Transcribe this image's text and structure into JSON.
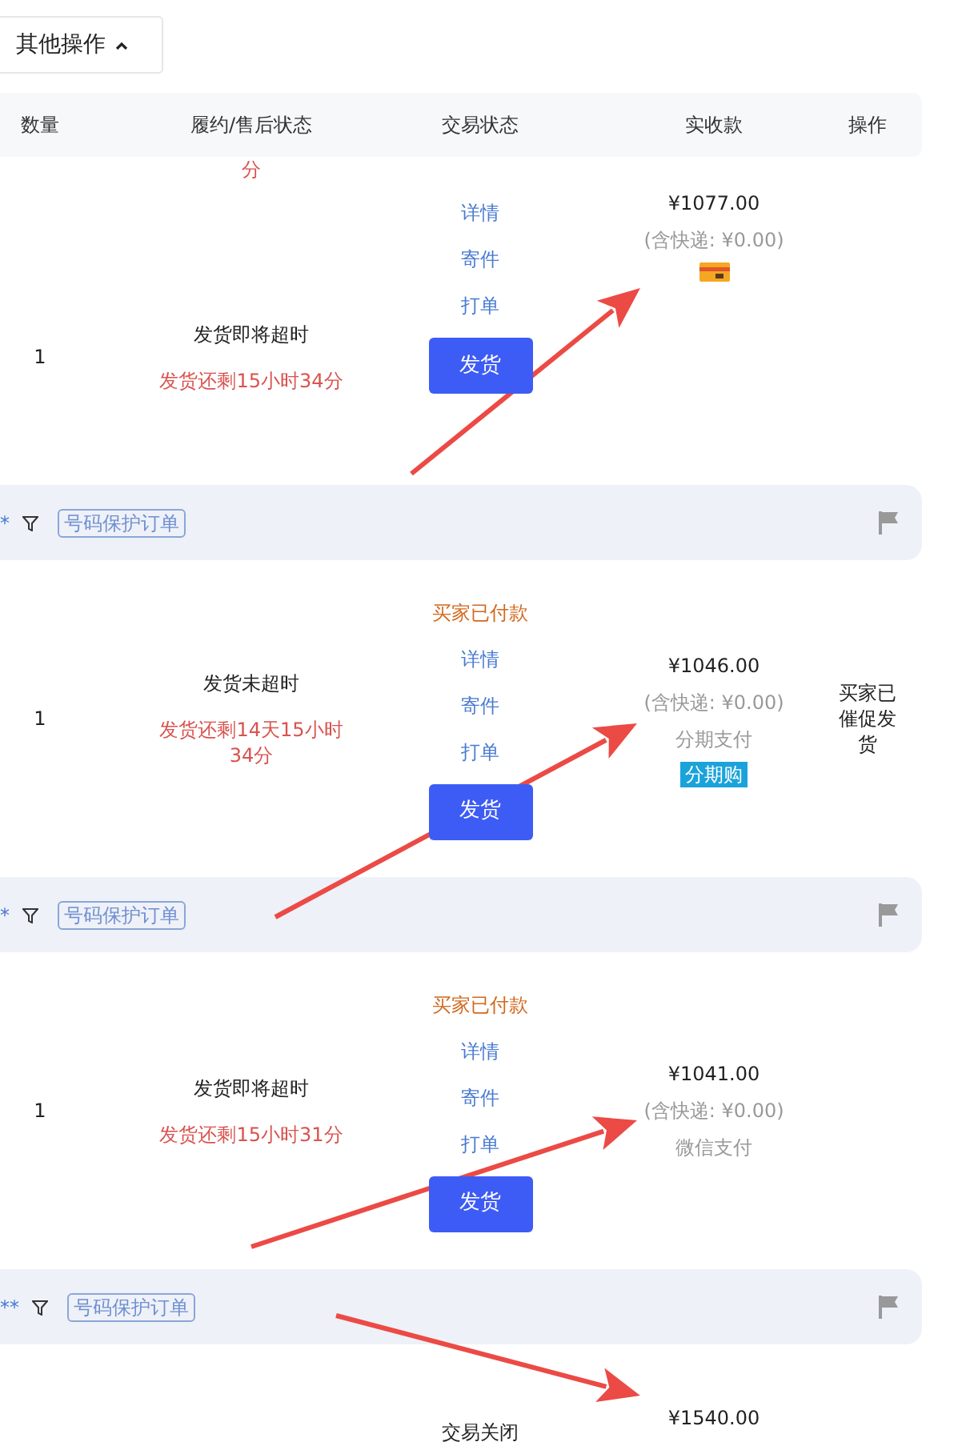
{
  "toolbar": {
    "dropdown": {
      "label": "其他操作",
      "expanded": true
    }
  },
  "table": {
    "columns": [
      "数量",
      "履约/售后状态",
      "交易状态",
      "实收款",
      "操作"
    ],
    "rows": [
      {
        "kind": "tail",
        "fulfillment": [
          {
            "kind": "countdown",
            "text": "分"
          }
        ]
      },
      {
        "kind": "order",
        "quantity": "1",
        "fulfillment": [
          {
            "kind": "title",
            "text": "发货即将超时"
          },
          {
            "kind": "countdown",
            "text": "发货还剩15小时34分"
          }
        ],
        "trade": [
          {
            "kind": "link",
            "text": "详情"
          },
          {
            "kind": "link",
            "text": "寄件"
          },
          {
            "kind": "link",
            "text": "打单"
          },
          {
            "kind": "button",
            "text": "发货"
          }
        ],
        "amount": [
          {
            "kind": "total",
            "text": "¥1077.00"
          },
          {
            "kind": "shipping",
            "text": "(含快递: ¥0.00)"
          },
          {
            "kind": "card_icon"
          }
        ]
      },
      {
        "kind": "group",
        "order_no": "*",
        "tag": "号码保护订单"
      },
      {
        "kind": "order",
        "quantity": "1",
        "fulfillment": [
          {
            "kind": "title",
            "text": "发货未超时"
          },
          {
            "kind": "countdown",
            "text": "发货还剩14天15小时34分"
          }
        ],
        "trade": [
          {
            "kind": "status",
            "text": "买家已付款"
          },
          {
            "kind": "link",
            "text": "详情"
          },
          {
            "kind": "link",
            "text": "寄件"
          },
          {
            "kind": "link",
            "text": "打单"
          },
          {
            "kind": "button",
            "text": "发货"
          }
        ],
        "amount": [
          {
            "kind": "total",
            "text": "¥1046.00"
          },
          {
            "kind": "shipping",
            "text": "(含快递: ¥0.00)"
          },
          {
            "kind": "method",
            "text": "分期支付"
          },
          {
            "kind": "badge",
            "text": "分期购"
          }
        ],
        "operation": "买家已催促发货"
      },
      {
        "kind": "group",
        "order_no": "*",
        "tag": "号码保护订单"
      },
      {
        "kind": "order",
        "quantity": "1",
        "fulfillment": [
          {
            "kind": "title",
            "text": "发货即将超时"
          },
          {
            "kind": "countdown",
            "text": "发货还剩15小时31分"
          }
        ],
        "trade": [
          {
            "kind": "status",
            "text": "买家已付款"
          },
          {
            "kind": "link",
            "text": "详情"
          },
          {
            "kind": "link",
            "text": "寄件"
          },
          {
            "kind": "link",
            "text": "打单"
          },
          {
            "kind": "button",
            "text": "发货"
          }
        ],
        "amount": [
          {
            "kind": "total",
            "text": "¥1041.00"
          },
          {
            "kind": "shipping",
            "text": "(含快递: ¥0.00)"
          },
          {
            "kind": "method",
            "text": "微信支付"
          }
        ]
      },
      {
        "kind": "group",
        "order_no": "**",
        "tag": "号码保护订单"
      },
      {
        "kind": "order",
        "trade": [
          {
            "kind": "closed",
            "text": "交易关闭"
          }
        ],
        "amount": [
          {
            "kind": "total",
            "text": "¥1540.00"
          }
        ]
      }
    ]
  }
}
